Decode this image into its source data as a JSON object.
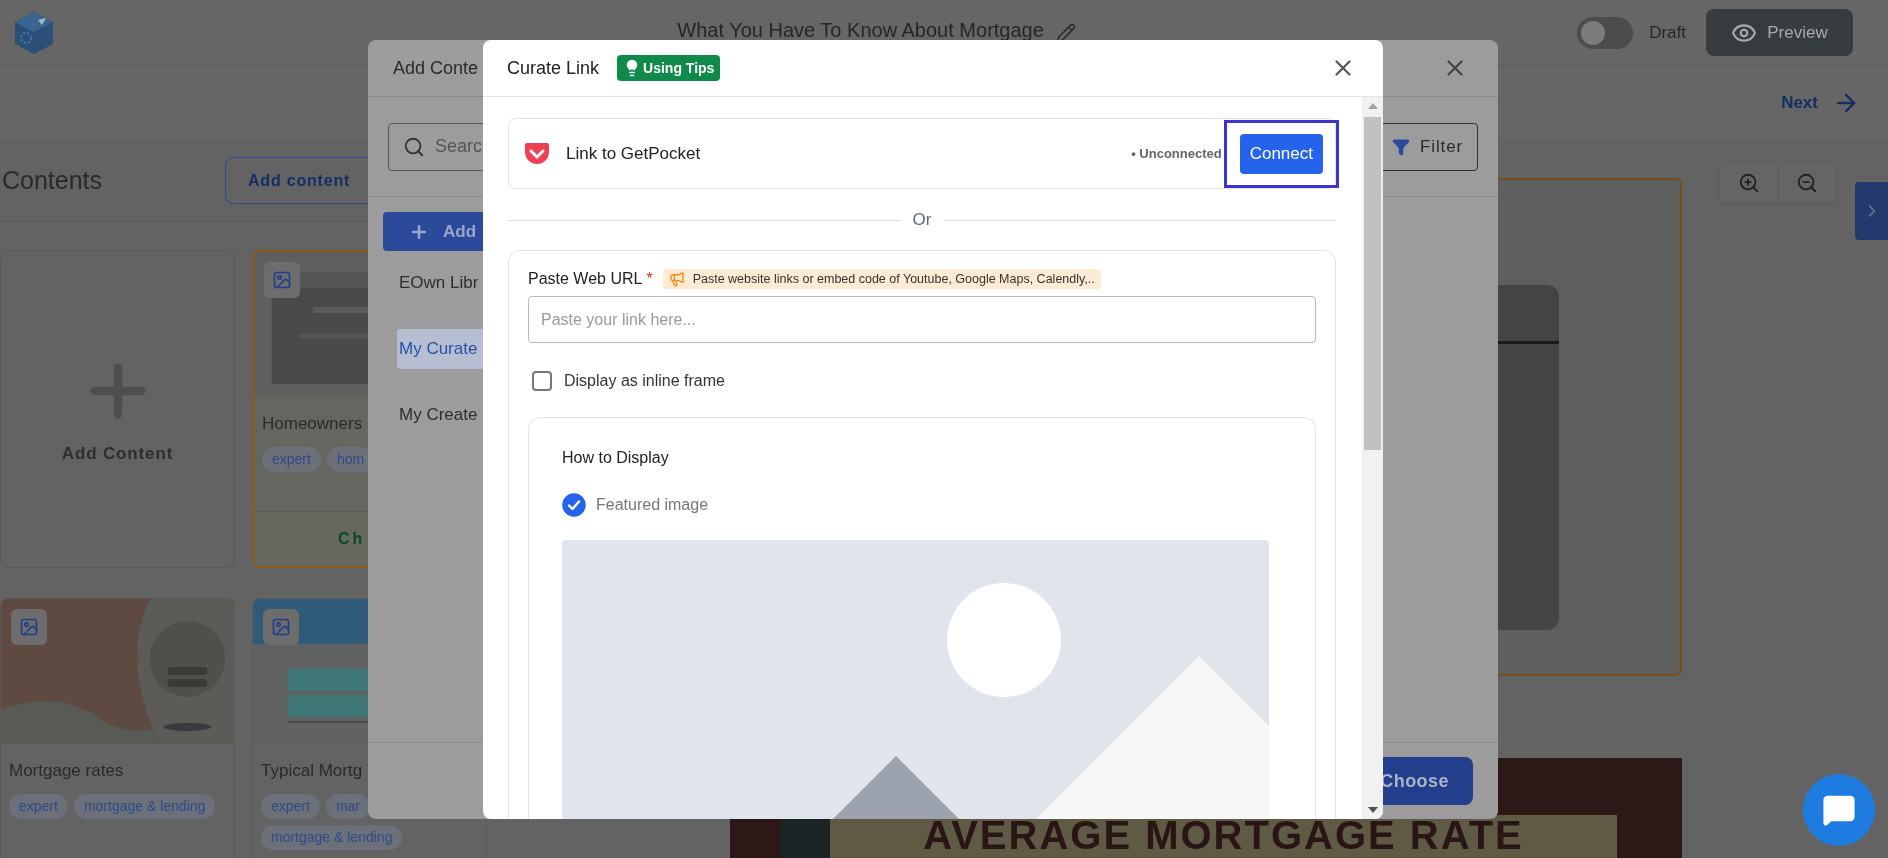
{
  "app_bar": {
    "title": "What You Have To Know About Mortgage",
    "draft_toggle": {
      "label": "Draft",
      "on": false
    },
    "preview_button": "Preview"
  },
  "step_bar": {
    "next_link": "Next"
  },
  "contents_panel": {
    "heading": "Contents",
    "add_button": "Add content",
    "cards": [
      {
        "kind": "add",
        "label": "Add Content"
      },
      {
        "kind": "item",
        "title": "Homeowners",
        "tags": [
          "expert",
          "hom"
        ],
        "selected": true,
        "action": "Ch"
      },
      {
        "kind": "item",
        "title": "Mortgage rates",
        "tags": [
          "expert",
          "mortgage & lending"
        ],
        "selected": false
      },
      {
        "kind": "item",
        "title": "Typical Mortg",
        "tags": [
          "expert",
          "mar",
          "mortgage & lending"
        ],
        "selected": false
      }
    ]
  },
  "canvas": {
    "banner": "AVERAGE MORTGAGE RATE"
  },
  "add_content_dialog": {
    "title": "Add Conte",
    "search_placeholder": "Searc",
    "filter_button": "Filter",
    "add_button": "Add",
    "library_items": [
      {
        "label": "EOwn Libr",
        "selected": false
      },
      {
        "label": "My Curate",
        "selected": true
      },
      {
        "label": "My Create",
        "selected": false
      }
    ],
    "choose_button": "Choose"
  },
  "curate_link_dialog": {
    "title": "Curate Link",
    "tips_badge": "Using Tips",
    "pocket": {
      "label": "Link to GetPocket",
      "status": "• Unconnected",
      "connect_button": "Connect",
      "highlighted": true
    },
    "divider": "Or",
    "url": {
      "label": "Paste Web URL",
      "required_mark": "*",
      "hint": "Paste website links or embed code of Youtube, Google Maps, Calendly,..",
      "placeholder": "Paste your link here..."
    },
    "inline_frame": {
      "label": "Display as inline frame",
      "checked": false
    },
    "display": {
      "heading": "How to Display",
      "options": [
        {
          "label": "Featured image",
          "checked": true
        }
      ]
    }
  }
}
